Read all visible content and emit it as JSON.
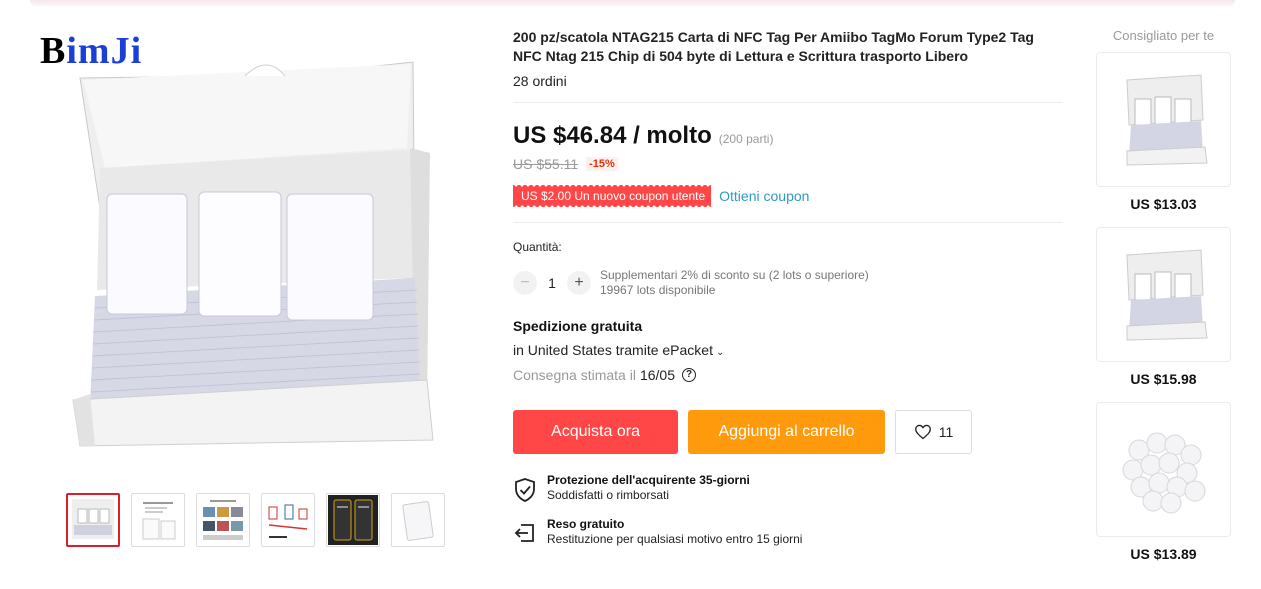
{
  "gallery": {
    "brand_part1": "B",
    "brand_part2": "imJi",
    "thumbnails": [
      {
        "name": "thumb-box-cards",
        "active": true
      },
      {
        "name": "thumb-card-specs",
        "active": false
      },
      {
        "name": "thumb-application-photos",
        "active": false
      },
      {
        "name": "thumb-usage-diagram",
        "active": false
      },
      {
        "name": "thumb-phone-screens",
        "active": false
      },
      {
        "name": "thumb-single-card",
        "active": false
      }
    ]
  },
  "product": {
    "title": "200 pz/scatola NTAG215 Carta di NFC Tag Per Amiibo TagMo Forum Type2 Tag NFC Ntag 215 Chip di 504 byte di Lettura e Scrittura trasporto Libero",
    "orders": "28 ordini",
    "price": "US $46.84 / molto",
    "price_note": "(200 parti)",
    "old_price": "US $55.11",
    "discount": "-15%",
    "coupon_tag": "US $2.00 Un nuovo coupon utente",
    "coupon_link": "Ottieni coupon"
  },
  "quantity": {
    "label": "Quantità:",
    "minus": "−",
    "value": "1",
    "plus": "+",
    "note_line1": "Supplementari 2% di sconto su (2 lots o superiore)",
    "note_line2": "19967 lots disponibile"
  },
  "shipping": {
    "title": "Spedizione gratuita",
    "method": "in United States tramite ePacket",
    "eta_label": "Consegna stimata il",
    "eta_date": "16/05",
    "help": "?"
  },
  "actions": {
    "buy_now": "Acquista ora",
    "add_to_cart": "Aggiungi al carrello",
    "wishlist_count": "11"
  },
  "guarantees": [
    {
      "title": "Protezione dell'acquirente 35-giorni",
      "desc": "Soddisfatti o rimborsati",
      "icon": "shield-check-icon"
    },
    {
      "title": "Reso gratuito",
      "desc": "Restituzione per qualsiasi motivo entro 15 giorni",
      "icon": "return-icon"
    }
  ],
  "recommendations": {
    "title": "Consigliato per te",
    "items": [
      {
        "price": "US $13.03",
        "image": "box-of-cards"
      },
      {
        "price": "US $15.98",
        "image": "box-of-cards"
      },
      {
        "price": "US $13.89",
        "image": "round-coin-tags"
      }
    ]
  },
  "colors": {
    "buy": "#ff4747",
    "cart": "#ff9a0d",
    "link": "#2e9cc3",
    "discount": "#e62e04",
    "active_thumb_border": "#d8202c"
  }
}
